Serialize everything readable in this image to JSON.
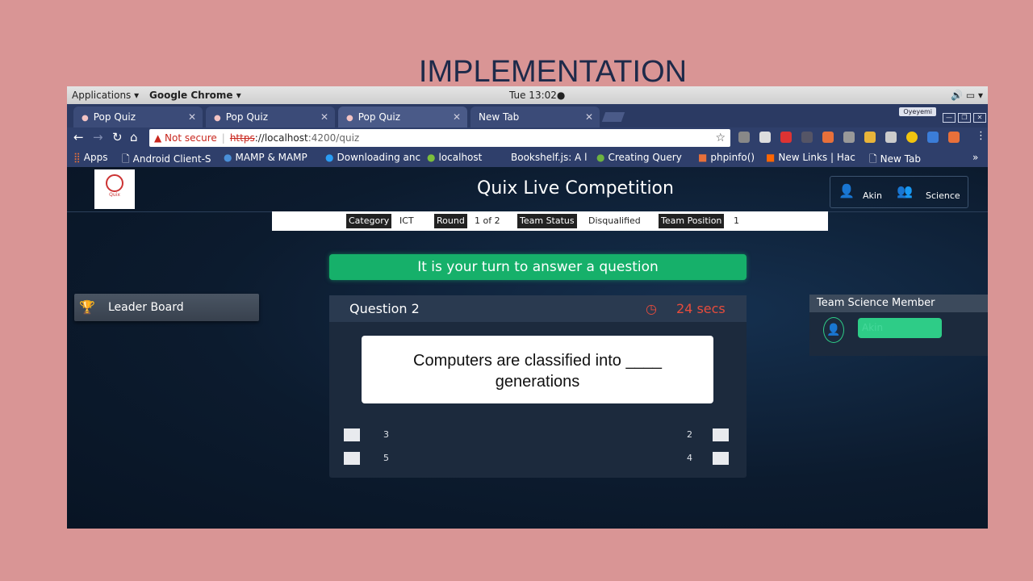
{
  "slide": {
    "title": "IMPLEMENTATION"
  },
  "os": {
    "applications": "Applications ▾",
    "app_menu": "Google Chrome ▾",
    "clock": "Tue 13:02●",
    "tray": "🔊 ▭ ▾"
  },
  "tabs": [
    {
      "label": "Pop Quiz"
    },
    {
      "label": "Pop Quiz"
    },
    {
      "label": "Pop Quiz"
    },
    {
      "label": "New Tab"
    }
  ],
  "window": {
    "profile": "Oyeyemi"
  },
  "address": {
    "security": "▲ Not secure",
    "scheme": "https",
    "host": "://localhost",
    "path": ":4200/quiz"
  },
  "bookmarks": [
    {
      "label": "Apps",
      "icon": "apps-grid-icon"
    },
    {
      "label": "Android Client-S",
      "icon": "page-icon"
    },
    {
      "label": "MAMP & MAMP",
      "icon": "elephant-icon"
    },
    {
      "label": "Downloading anc",
      "icon": "skype-icon"
    },
    {
      "label": "localhost",
      "icon": "leaf-icon"
    },
    {
      "label": "Bookshelf.js: A l",
      "icon": "blank-icon"
    },
    {
      "label": "Creating Query",
      "icon": "spring-icon"
    },
    {
      "label": "phpinfo()",
      "icon": "php-icon"
    },
    {
      "label": "New Links | Hac",
      "icon": "y-icon"
    },
    {
      "label": "New Tab",
      "icon": "page-icon"
    },
    {
      "label": "»",
      "icon": "more-icon"
    }
  ],
  "app": {
    "logo_text": "Quix",
    "title": "Quix Live Competition",
    "user_name": "Akin",
    "team_name": "Science",
    "info": {
      "category_label": "Category",
      "category_value": "ICT",
      "round_label": "Round",
      "round_value": "1 of 2",
      "status_label": "Team Status",
      "status_value": "Disqualified",
      "position_label": "Team Position",
      "position_value": "1"
    },
    "turn_message": "It is your turn to answer a question",
    "leaderboard": "Leader Board",
    "question": {
      "number": "Question 2",
      "timer": "24 secs",
      "text": "Computers are classified into ____ generations",
      "options": [
        "3",
        "2",
        "5",
        "4"
      ]
    },
    "team_panel": {
      "title": "Team Science Member",
      "member": "Akin"
    }
  },
  "colors": {
    "background": "#d99595",
    "accent_green": "#16b06a",
    "timer_red": "#e74c3c",
    "app_bg": "#0c1b2e"
  }
}
